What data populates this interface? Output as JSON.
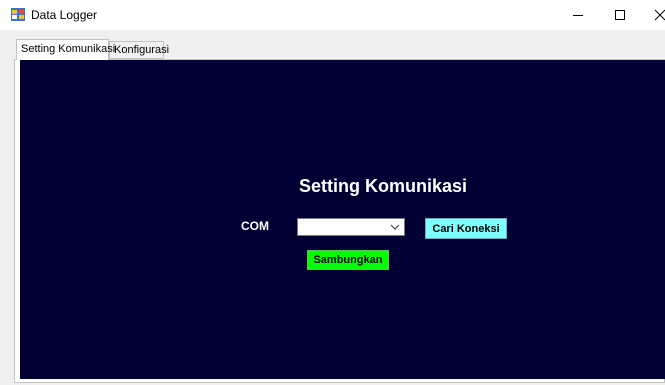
{
  "window": {
    "title": "Data Logger",
    "icon": "data-logger-app-icon",
    "controls": {
      "minimize": "minimize-icon",
      "maximize": "maximize-icon",
      "close": "close-icon"
    }
  },
  "tabs": [
    {
      "label": "Setting Komunikasi",
      "selected": true
    },
    {
      "label": "Konfigurasi",
      "selected": false
    }
  ],
  "panel": {
    "background_color": "#000033",
    "heading": "Setting Komunikasi",
    "com_label": "COM",
    "com_select": {
      "value": ""
    },
    "search_button": {
      "label": "Cari Koneksi",
      "color": "#80ffff"
    },
    "connect_button": {
      "label": "Sambungkan",
      "color": "#00ff00"
    }
  }
}
